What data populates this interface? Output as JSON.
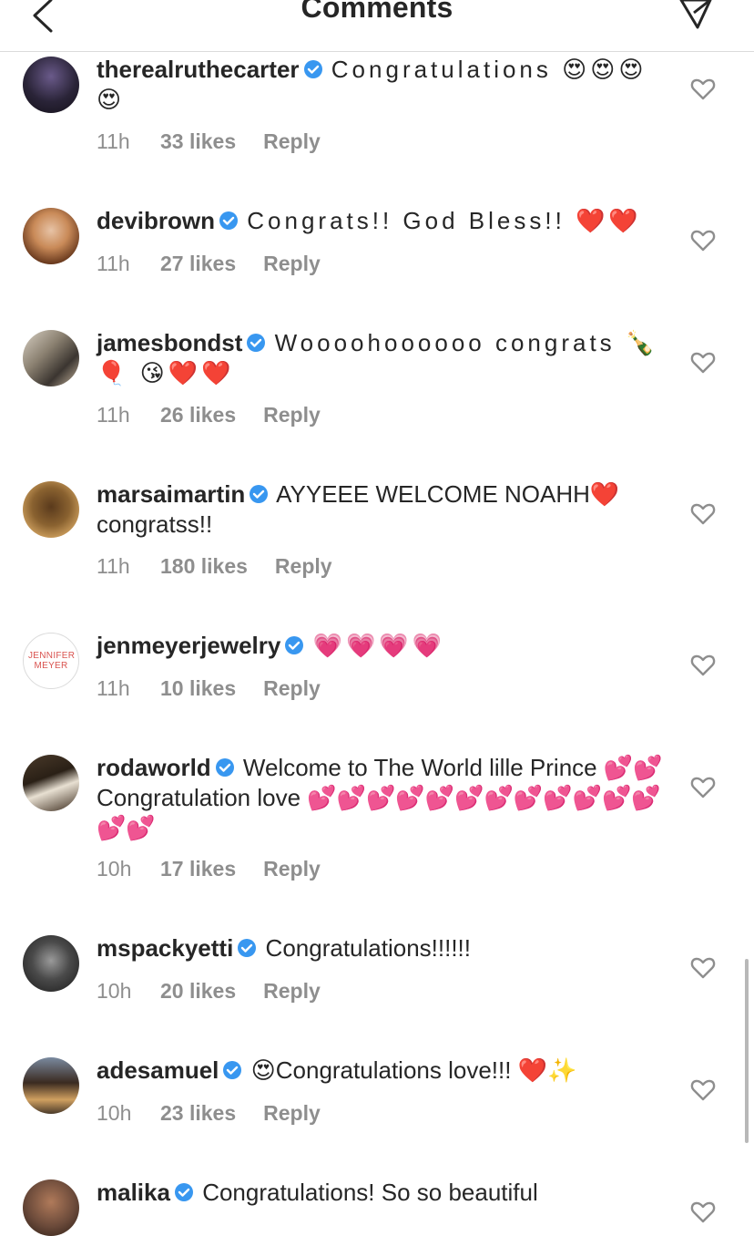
{
  "header": {
    "title": "Comments",
    "back_icon": "back-arrow-icon",
    "share_icon": "paper-plane-icon"
  },
  "colors": {
    "verified": "#3897f0",
    "meta": "#8e8e8e",
    "text": "#262626",
    "divider": "#dbdbdb"
  },
  "reply_label": "Reply",
  "comments": [
    {
      "username": "therealruthecarter",
      "verified": true,
      "text": "Congratulations 😍😍😍😍",
      "time": "11h",
      "likes": "33 likes",
      "avatar_color": "#1f1c2c"
    },
    {
      "username": "devibrown",
      "verified": true,
      "text": "Congrats!! God Bless!! ❤️❤️",
      "time": "11h",
      "likes": "27 likes",
      "avatar_color": "#b06a3a"
    },
    {
      "username": "jamesbondst",
      "verified": true,
      "text": "Woooohoooooo congrats 🍾🎈 😘❤️❤️",
      "time": "11h",
      "likes": "26 likes",
      "avatar_color": "#7a7a7a"
    },
    {
      "username": "marsaimartin",
      "verified": true,
      "text": "AYYEEE WELCOME NOAHH❤️ congratss!!",
      "time": "11h",
      "likes": "180 likes",
      "avatar_color": "#8a5a2b"
    },
    {
      "username": "jenmeyerjewelry",
      "verified": true,
      "text": "💗💗💗💗",
      "time": "11h",
      "likes": "10 likes",
      "avatar_text": "JENNIFER MEYER"
    },
    {
      "username": "rodaworld",
      "verified": true,
      "text": "Welcome to The World lille Prince 💕💕Congratulation love 💕💕💕💕💕💕💕💕💕💕💕💕💕💕",
      "time": "10h",
      "likes": "17 likes",
      "avatar_color": "#3b3226"
    },
    {
      "username": "mspackyetti",
      "verified": true,
      "text": "Congratulations!!!!!!",
      "time": "10h",
      "likes": "20 likes",
      "avatar_color": "#2b2b2b"
    },
    {
      "username": "adesamuel",
      "verified": true,
      "text": "😍Congratulations love!!! ❤️✨",
      "time": "10h",
      "likes": "23 likes",
      "avatar_color": "#5a4636"
    },
    {
      "username": "malika",
      "verified": true,
      "text": "Congratulations! So so beautiful",
      "avatar_color": "#6b4a3a"
    }
  ]
}
